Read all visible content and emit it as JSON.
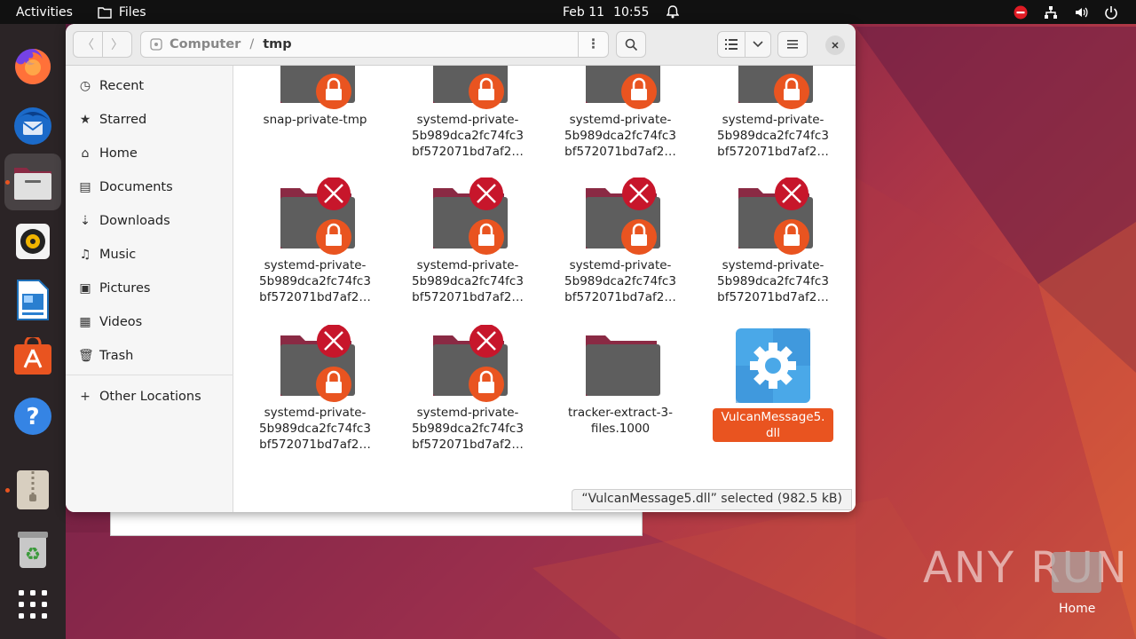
{
  "topbar": {
    "activities": "Activities",
    "app_name": "Files",
    "date": "Feb 11",
    "time": "10:55"
  },
  "dock": {
    "items": [
      {
        "name": "firefox",
        "running": false
      },
      {
        "name": "thunderbird",
        "running": false
      },
      {
        "name": "files",
        "running": true
      },
      {
        "name": "rhythmbox",
        "running": false
      },
      {
        "name": "libreoffice-writer",
        "running": false
      },
      {
        "name": "app-center",
        "running": false
      },
      {
        "name": "help",
        "running": false
      },
      {
        "name": "archive-manager",
        "running": true
      },
      {
        "name": "trash",
        "running": false
      },
      {
        "name": "show-apps",
        "running": false
      }
    ]
  },
  "window": {
    "path": [
      "Computer",
      "tmp"
    ],
    "sidebar": [
      {
        "label": "Recent",
        "icon": "clock-icon"
      },
      {
        "label": "Starred",
        "icon": "star-icon"
      },
      {
        "label": "Home",
        "icon": "home-icon"
      },
      {
        "label": "Documents",
        "icon": "document-icon"
      },
      {
        "label": "Downloads",
        "icon": "download-icon"
      },
      {
        "label": "Music",
        "icon": "music-icon"
      },
      {
        "label": "Pictures",
        "icon": "picture-icon"
      },
      {
        "label": "Videos",
        "icon": "video-icon"
      },
      {
        "label": "Trash",
        "icon": "trash-icon"
      },
      {
        "label": "Other Locations",
        "icon": "plus-icon"
      }
    ],
    "files": [
      {
        "label": "snap-private-tmp",
        "type": "locked"
      },
      {
        "label": "systemd-private-\n5b989dca2fc74fc3\nbf572071bd7af2…",
        "type": "locked"
      },
      {
        "label": "systemd-private-\n5b989dca2fc74fc3\nbf572071bd7af2…",
        "type": "locked"
      },
      {
        "label": "systemd-private-\n5b989dca2fc74fc3\nbf572071bd7af2…",
        "type": "locked"
      },
      {
        "label": "systemd-private-\n5b989dca2fc74fc3\nbf572071bd7af2…",
        "type": "denied"
      },
      {
        "label": "systemd-private-\n5b989dca2fc74fc3\nbf572071bd7af2…",
        "type": "denied"
      },
      {
        "label": "systemd-private-\n5b989dca2fc74fc3\nbf572071bd7af2…",
        "type": "denied"
      },
      {
        "label": "systemd-private-\n5b989dca2fc74fc3\nbf572071bd7af2…",
        "type": "denied"
      },
      {
        "label": "systemd-private-\n5b989dca2fc74fc3\nbf572071bd7af2…",
        "type": "denied"
      },
      {
        "label": "systemd-private-\n5b989dca2fc74fc3\nbf572071bd7af2…",
        "type": "denied"
      },
      {
        "label": "tracker-extract-3-\nfiles.1000",
        "type": "folder"
      },
      {
        "label": "VulcanMessage5.\ndll",
        "type": "dll",
        "selected": true
      }
    ],
    "status": "“VulcanMessage5.dll” selected  (982.5 kB)"
  },
  "desktop": {
    "home_label": "Home",
    "watermark": "ANY RUN"
  },
  "colors": {
    "accent": "#e95420",
    "folder_body": "#5e5e5e",
    "folder_tab": "#8a2a44",
    "denied": "#c7162b"
  }
}
